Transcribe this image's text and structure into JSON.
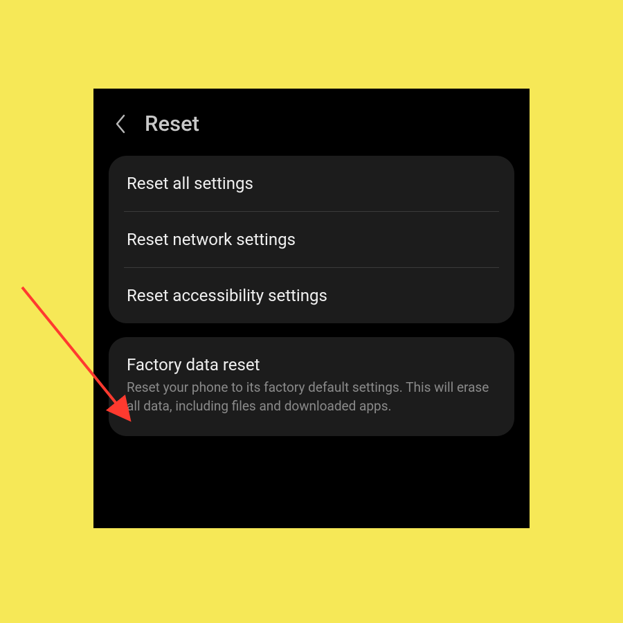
{
  "header": {
    "title": "Reset"
  },
  "card1": {
    "items": [
      {
        "label": "Reset all settings"
      },
      {
        "label": "Reset network settings"
      },
      {
        "label": "Reset accessibility settings"
      }
    ]
  },
  "card2": {
    "title": "Factory data reset",
    "description": "Reset your phone to its factory default settings. This will erase all data, including files and downloaded apps."
  },
  "annotation": {
    "arrow_color": "#ff3a2f"
  }
}
